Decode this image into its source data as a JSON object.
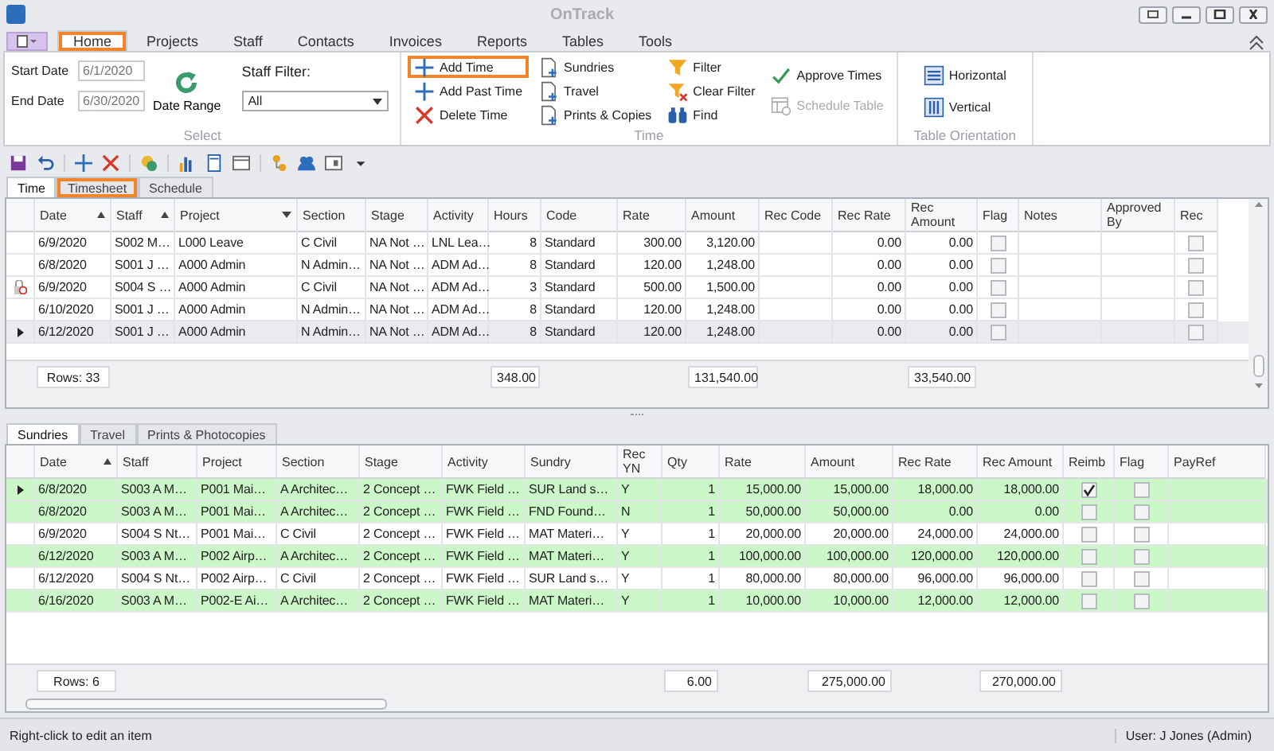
{
  "window": {
    "title": "OnTrack"
  },
  "ribbon": {
    "tabs": [
      {
        "label": "Home",
        "selected": true,
        "highlighted": true
      },
      {
        "label": "Projects",
        "selected": false,
        "highlighted": false
      },
      {
        "label": "Staff",
        "selected": false,
        "highlighted": false
      },
      {
        "label": "Contacts",
        "selected": false,
        "highlighted": false
      },
      {
        "label": "Invoices",
        "selected": false,
        "highlighted": false
      },
      {
        "label": "Reports",
        "selected": false,
        "highlighted": false
      },
      {
        "label": "Tables",
        "selected": false,
        "highlighted": false
      },
      {
        "label": "Tools",
        "selected": false,
        "highlighted": false
      }
    ],
    "select_group": {
      "label": "Select",
      "start_date": {
        "label": "Start Date",
        "value": "6/1/2020"
      },
      "end_date": {
        "label": "End Date",
        "value": "6/30/2020"
      },
      "date_range": "Date Range",
      "staff_filter": {
        "label": "Staff Filter:",
        "value": "All"
      }
    },
    "time_group": {
      "label": "Time",
      "columns": [
        [
          {
            "label": "Add Time",
            "highlighted": true,
            "disabled": false
          },
          {
            "label": "Add Past Time",
            "highlighted": false,
            "disabled": false
          },
          {
            "label": "Delete Time",
            "highlighted": false,
            "disabled": false
          }
        ],
        [
          {
            "label": "Sundries",
            "highlighted": false,
            "disabled": false
          },
          {
            "label": "Travel",
            "highlighted": false,
            "disabled": false
          },
          {
            "label": "Prints & Copies",
            "highlighted": false,
            "disabled": false
          }
        ],
        [
          {
            "label": "Filter",
            "highlighted": false,
            "disabled": false
          },
          {
            "label": "Clear Filter",
            "highlighted": false,
            "disabled": false
          },
          {
            "label": "Find",
            "highlighted": false,
            "disabled": false
          }
        ],
        [
          {
            "label": "Approve Times",
            "highlighted": false,
            "disabled": false
          },
          {
            "label": "Schedule Table",
            "highlighted": false,
            "disabled": true
          }
        ]
      ]
    },
    "orientation_group": {
      "label": "Table Orientation",
      "buttons": [
        {
          "label": "Horizontal",
          "highlighted": false,
          "disabled": false
        },
        {
          "label": "Vertical",
          "highlighted": false,
          "disabled": false
        }
      ]
    }
  },
  "upper_grid": {
    "tabs": [
      {
        "label": "Time",
        "selected": true,
        "highlighted": false
      },
      {
        "label": "Timesheet",
        "selected": false,
        "highlighted": true
      },
      {
        "label": "Schedule",
        "selected": false,
        "highlighted": false
      }
    ],
    "columns": [
      {
        "header": "Date",
        "sorted": true,
        "dropdown": false,
        "kind": "text",
        "total": "Rows: 33"
      },
      {
        "header": "Staff",
        "sorted": true,
        "dropdown": false,
        "kind": "text"
      },
      {
        "header": "Project",
        "sorted": false,
        "dropdown": true,
        "kind": "text"
      },
      {
        "header": "Section",
        "sorted": false,
        "dropdown": false,
        "kind": "text"
      },
      {
        "header": "Stage",
        "sorted": false,
        "dropdown": false,
        "kind": "text"
      },
      {
        "header": "Activity",
        "sorted": false,
        "dropdown": false,
        "kind": "text"
      },
      {
        "header": "Hours",
        "sorted": false,
        "dropdown": false,
        "kind": "number",
        "total": "348.00"
      },
      {
        "header": "Code",
        "sorted": false,
        "dropdown": false,
        "kind": "text"
      },
      {
        "header": "Rate",
        "sorted": false,
        "dropdown": false,
        "kind": "number"
      },
      {
        "header": "Amount",
        "sorted": false,
        "dropdown": false,
        "kind": "number",
        "total": "131,540.00"
      },
      {
        "header": "Rec Code",
        "sorted": false,
        "dropdown": false,
        "kind": "text"
      },
      {
        "header": "Rec Rate",
        "sorted": false,
        "dropdown": false,
        "kind": "number"
      },
      {
        "header": "Rec Amount",
        "sorted": false,
        "dropdown": false,
        "kind": "number",
        "total": "33,540.00"
      },
      {
        "header": "Flag",
        "sorted": false,
        "dropdown": false,
        "kind": "check"
      },
      {
        "header": "Notes",
        "sorted": false,
        "dropdown": false,
        "kind": "text"
      },
      {
        "header": "Approved By",
        "sorted": false,
        "dropdown": false,
        "kind": "text"
      },
      {
        "header": "Rec",
        "sorted": false,
        "dropdown": false,
        "kind": "check"
      }
    ],
    "rows": [
      {
        "current": false,
        "locked": false,
        "cells": [
          "6/9/2020",
          "S002 M…",
          "L000 Leave",
          "C Civil",
          "NA Not …",
          "LNL Lea…",
          "8",
          "Standard",
          "300.00",
          "3,120.00",
          "",
          "0.00",
          "0.00",
          false,
          "",
          "",
          false
        ]
      },
      {
        "current": false,
        "locked": false,
        "cells": [
          "6/8/2020",
          "S001 J …",
          "A000 Admin",
          "N Admin…",
          "NA Not …",
          "ADM Ad…",
          "8",
          "Standard",
          "120.00",
          "1,248.00",
          "",
          "0.00",
          "0.00",
          false,
          "",
          "",
          false
        ]
      },
      {
        "current": false,
        "locked": true,
        "cells": [
          "6/9/2020",
          "S004 S …",
          "A000 Admin",
          "C Civil",
          "NA Not …",
          "ADM Ad…",
          "3",
          "Standard",
          "500.00",
          "1,500.00",
          "",
          "0.00",
          "0.00",
          false,
          "",
          "",
          false
        ]
      },
      {
        "current": false,
        "locked": false,
        "cells": [
          "6/10/2020",
          "S001 J …",
          "A000 Admin",
          "N Admin…",
          "NA Not …",
          "ADM Ad…",
          "8",
          "Standard",
          "120.00",
          "1,248.00",
          "",
          "0.00",
          "0.00",
          false,
          "",
          "",
          false
        ]
      },
      {
        "current": true,
        "locked": false,
        "cells": [
          "6/12/2020",
          "S001 J …",
          "A000 Admin",
          "N Admin…",
          "NA Not …",
          "ADM Ad…",
          "8",
          "Standard",
          "120.00",
          "1,248.00",
          "",
          "0.00",
          "0.00",
          false,
          "",
          "",
          false
        ]
      }
    ]
  },
  "lower_grid": {
    "tabs": [
      {
        "label": "Sundries",
        "selected": true,
        "highlighted": false
      },
      {
        "label": "Travel",
        "selected": false,
        "highlighted": false
      },
      {
        "label": "Prints & Photocopies",
        "selected": false,
        "highlighted": false
      }
    ],
    "columns": [
      {
        "header": "Date",
        "sorted": true,
        "dropdown": false,
        "kind": "text",
        "total": "Rows: 6"
      },
      {
        "header": "Staff",
        "sorted": false,
        "dropdown": false,
        "kind": "text"
      },
      {
        "header": "Project",
        "sorted": false,
        "dropdown": false,
        "kind": "text"
      },
      {
        "header": "Section",
        "sorted": false,
        "dropdown": false,
        "kind": "text"
      },
      {
        "header": "Stage",
        "sorted": false,
        "dropdown": false,
        "kind": "text"
      },
      {
        "header": "Activity",
        "sorted": false,
        "dropdown": false,
        "kind": "text"
      },
      {
        "header": "Sundry",
        "sorted": false,
        "dropdown": false,
        "kind": "text"
      },
      {
        "header": "Rec YN",
        "sorted": false,
        "dropdown": false,
        "kind": "text"
      },
      {
        "header": "Qty",
        "sorted": false,
        "dropdown": false,
        "kind": "number",
        "total": "6.00"
      },
      {
        "header": "Rate",
        "sorted": false,
        "dropdown": false,
        "kind": "number"
      },
      {
        "header": "Amount",
        "sorted": false,
        "dropdown": false,
        "kind": "number",
        "total": "275,000.00"
      },
      {
        "header": "Rec Rate",
        "sorted": false,
        "dropdown": false,
        "kind": "number"
      },
      {
        "header": "Rec Amount",
        "sorted": false,
        "dropdown": false,
        "kind": "number",
        "total": "270,000.00"
      },
      {
        "header": "Reimb",
        "sorted": false,
        "dropdown": false,
        "kind": "check"
      },
      {
        "header": "Flag",
        "sorted": false,
        "dropdown": false,
        "kind": "check"
      },
      {
        "header": "PayRef",
        "sorted": false,
        "dropdown": false,
        "kind": "text"
      }
    ],
    "rows": [
      {
        "current": true,
        "locked": false,
        "color": "#ccf7c8",
        "cells": [
          "6/8/2020",
          "S003 A M…",
          "P001 Mai…",
          "A Architec…",
          "2 Concept …",
          "FWK Field …",
          "SUR Land s…",
          "Y",
          "1",
          "15,000.00",
          "15,000.00",
          "18,000.00",
          "18,000.00",
          true,
          false,
          ""
        ]
      },
      {
        "current": false,
        "locked": false,
        "color": "#ccf7c8",
        "cells": [
          "6/8/2020",
          "S003 A M…",
          "P001 Mai…",
          "A Architec…",
          "2 Concept …",
          "FWK Field …",
          "FND Found…",
          "N",
          "1",
          "50,000.00",
          "50,000.00",
          "0.00",
          "0.00",
          false,
          false,
          ""
        ]
      },
      {
        "current": false,
        "locked": false,
        "color": "#ffffff",
        "cells": [
          "6/9/2020",
          "S004 S Nt…",
          "P001 Mai…",
          "C Civil",
          "2 Concept …",
          "FWK Field …",
          "MAT Materi…",
          "Y",
          "1",
          "20,000.00",
          "20,000.00",
          "24,000.00",
          "24,000.00",
          false,
          false,
          ""
        ]
      },
      {
        "current": false,
        "locked": false,
        "color": "#ccf7c8",
        "cells": [
          "6/12/2020",
          "S003 A M…",
          "P002 Airp…",
          "A Architec…",
          "2 Concept …",
          "FWK Field …",
          "MAT Materi…",
          "Y",
          "1",
          "100,000.00",
          "100,000.00",
          "120,000.00",
          "120,000.00",
          false,
          false,
          ""
        ]
      },
      {
        "current": false,
        "locked": false,
        "color": "#ffffff",
        "cells": [
          "6/12/2020",
          "S004 S Nt…",
          "P002 Airp…",
          "C Civil",
          "2 Concept …",
          "FWK Field …",
          "SUR Land s…",
          "Y",
          "1",
          "80,000.00",
          "80,000.00",
          "96,000.00",
          "96,000.00",
          false,
          false,
          ""
        ]
      },
      {
        "current": false,
        "locked": false,
        "color": "#ccf7c8",
        "cells": [
          "6/16/2020",
          "S003 A M…",
          "P002-E Ai…",
          "A Architec…",
          "2 Concept …",
          "FWK Field …",
          "MAT Materi…",
          "Y",
          "1",
          "10,000.00",
          "10,000.00",
          "12,000.00",
          "12,000.00",
          false,
          false,
          ""
        ]
      }
    ]
  },
  "status_bar": {
    "hint": "Right-click to edit an item",
    "user": "User: J Jones (Admin)"
  }
}
